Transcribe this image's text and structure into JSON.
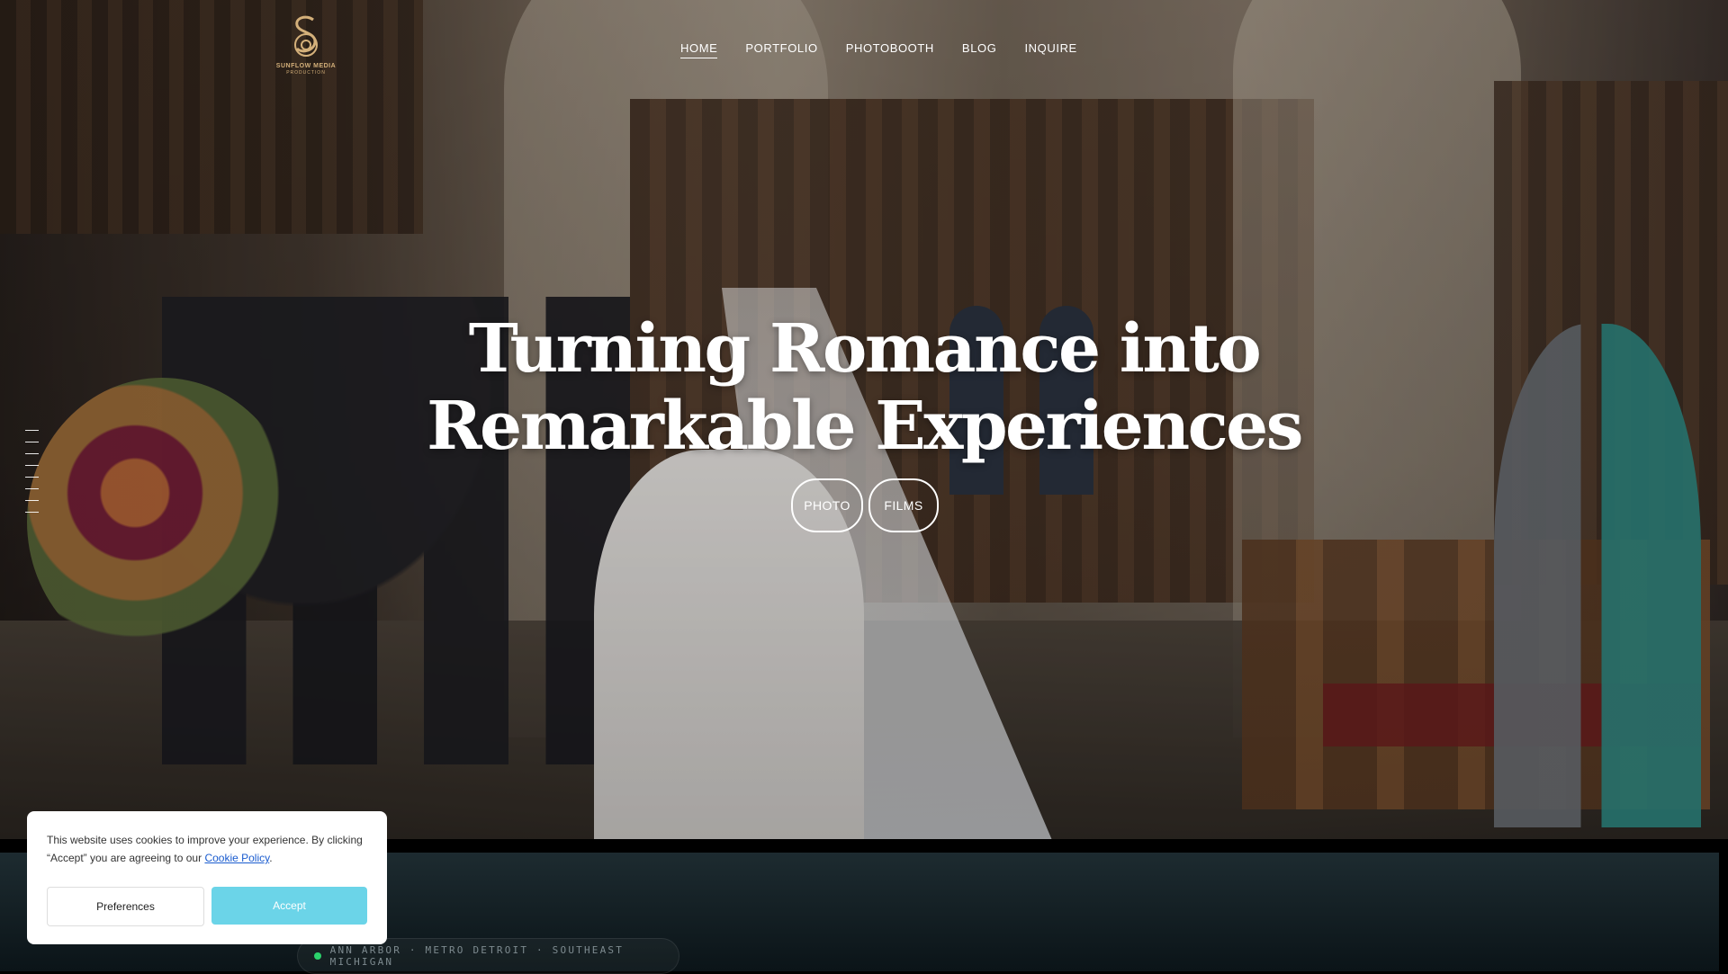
{
  "brand": {
    "name": "SUNFLOW MEDIA",
    "subname": "PRODUCTION",
    "logo_icon": "s-monogram-icon",
    "color": "#d4b07a"
  },
  "nav": {
    "items": [
      {
        "label": "HOME",
        "active": true
      },
      {
        "label": "PORTFOLIO",
        "active": false
      },
      {
        "label": "PHOTOBOOTH",
        "active": false
      },
      {
        "label": "BLOG",
        "active": false
      },
      {
        "label": "INQUIRE",
        "active": false
      }
    ]
  },
  "hero": {
    "headline_line1": "Turning Romance into",
    "headline_line2": "Remarkable Experiences",
    "buttons": [
      {
        "label": "PHOTO"
      },
      {
        "label": "FILMS"
      }
    ]
  },
  "location": {
    "text": "ANN ARBOR · METRO DETROIT · SOUTHEAST MICHIGAN",
    "status_color": "#2bd16b"
  },
  "cookie": {
    "text_before_link": "This website uses cookies to improve your experience. By clicking “Accept” you are agreeing to our ",
    "link_label": "Cookie Policy",
    "text_after_link": ".",
    "preferences_label": "Preferences",
    "accept_label": "Accept",
    "accent": "#6bd4e8"
  }
}
